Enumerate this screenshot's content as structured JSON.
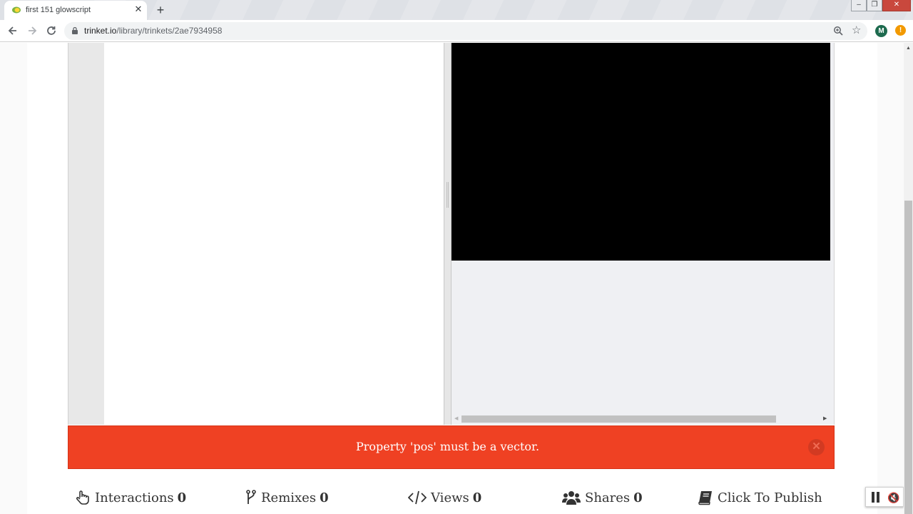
{
  "browser": {
    "tab_title": "first 151 glowscript",
    "tab_close": "✕",
    "new_tab": "+",
    "url_host": "trinket.io",
    "url_path": "/library/trinkets/2ae7934958",
    "profile_initial": "M",
    "alert_glyph": "!",
    "icons": [
      "back-arrow-icon",
      "forward-arrow-icon",
      "reload-icon",
      "lock-icon",
      "zoom-icon",
      "star-icon"
    ]
  },
  "error": {
    "message": "Property 'pos' must be a vector.",
    "close_glyph": "✕"
  },
  "stats": {
    "interactions_label": "Interactions",
    "interactions_count": "0",
    "remixes_label": "Remixes",
    "remixes_count": "0",
    "views_label": "Views",
    "views_count": "0",
    "shares_label": "Shares",
    "shares_count": "0",
    "publish_label": "Click To Publish"
  },
  "colors": {
    "error_bar": "#ef4123",
    "canvas": "#000000",
    "output_bg": "#eff0f3"
  }
}
